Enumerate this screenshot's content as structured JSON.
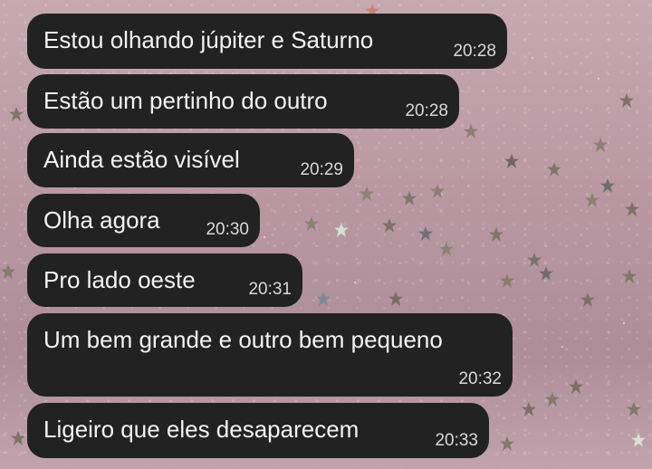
{
  "chat": {
    "messages": [
      {
        "text": "Estou olhando júpiter e Saturno",
        "time": "20:28"
      },
      {
        "text": "Estão um pertinho do outro",
        "time": "20:28"
      },
      {
        "text": "Ainda estão visível",
        "time": "20:29"
      },
      {
        "text": "Olha agora",
        "time": "20:30"
      },
      {
        "text": "Pro lado oeste",
        "time": "20:31"
      },
      {
        "text": "Um bem grande e outro bem pequeno",
        "time": "20:32"
      },
      {
        "text": "Ligeiro que eles desaparecem",
        "time": "20:33"
      }
    ]
  },
  "colors": {
    "bubble": "#222222",
    "text": "#f3f3f3",
    "timestamp": "#d9d9d9",
    "wallpaper": "#b998a2"
  }
}
